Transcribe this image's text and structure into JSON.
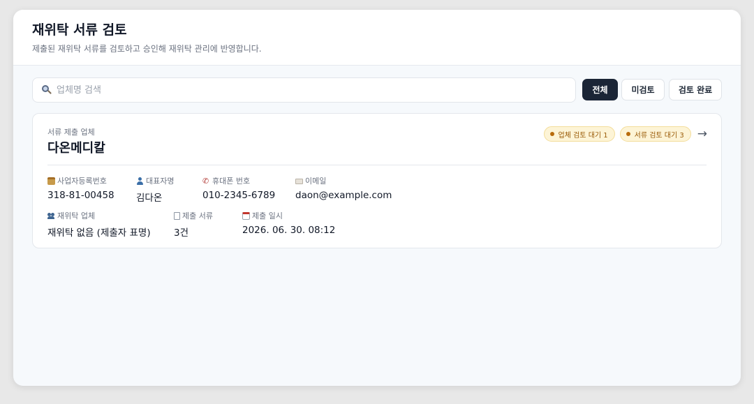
{
  "header": {
    "title": "재위탁 서류 검토",
    "subtitle": "제출된 재위탁 서류를 검토하고 승인해 재위탁 관리에 반영합니다."
  },
  "search": {
    "placeholder": "업체명 검색",
    "value": ""
  },
  "filters": [
    {
      "label": "전체",
      "active": true
    },
    {
      "label": "미검토",
      "active": false
    },
    {
      "label": "검토 완료",
      "active": false
    }
  ],
  "card": {
    "label": "서류 제출 업체",
    "name": "다온메디칼",
    "badges": [
      {
        "label": "업체 검토 대기 1",
        "color": "#b86b0c"
      },
      {
        "label": "서류 검토 대기 3",
        "color": "#b86b0c"
      }
    ],
    "fields": {
      "business_number": {
        "label": "사업자등록번호",
        "value": "318-81-00458",
        "icon": "id-card-icon"
      },
      "representative": {
        "label": "대표자명",
        "value": "김다온",
        "icon": "person-icon"
      },
      "phone": {
        "label": "휴대폰 번호",
        "value": "010-2345-6789",
        "icon": "phone-icon"
      },
      "email": {
        "label": "이메일",
        "value": "daon@example.com",
        "icon": "envelope-icon"
      },
      "subcontractor": {
        "label": "재위탁 업체",
        "value": "재위탁 없음 (제출자 표명)",
        "icon": "people-icon"
      },
      "documents": {
        "label": "제출 서류",
        "value": "3건",
        "icon": "document-icon"
      },
      "submitted_at": {
        "label": "제출 일시",
        "value": "2026. 06. 30. 08:12",
        "icon": "calendar-icon"
      }
    }
  },
  "colors": {
    "primary": "#1b2536",
    "badge_bg": "#fdf4d6",
    "badge_text": "#9a5b08"
  }
}
